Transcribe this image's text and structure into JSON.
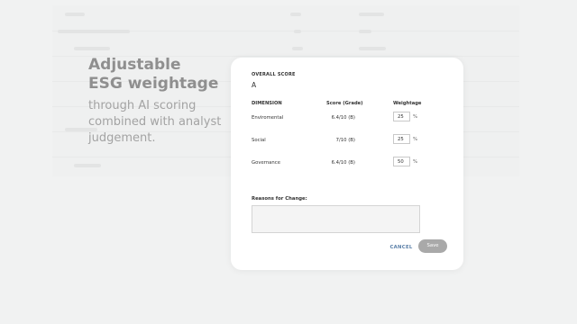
{
  "promo": {
    "title_line1": "Adjustable",
    "title_line2": "ESG weightage",
    "subtitle_line1": "through AI scoring",
    "subtitle_line2": "combined with analyst",
    "subtitle_line3": "judgement."
  },
  "modal": {
    "overall_label": "OVERALL SCORE",
    "overall_value": "A",
    "headers": {
      "dimension": "DIMENSION",
      "score": "Score (Grade)",
      "weightage": "Weightage"
    },
    "rows": [
      {
        "dimension": "Enviromental",
        "score": "6.4/10 (B)",
        "weight": "25",
        "unit": "%"
      },
      {
        "dimension": "Social",
        "score": "7/10 (B)",
        "weight": "25",
        "unit": "%"
      },
      {
        "dimension": "Governance",
        "score": "6.4/10 (B)",
        "weight": "50",
        "unit": "%"
      }
    ],
    "reasons_label": "Reasons for Change:",
    "reasons_value": "",
    "cancel_label": "CANCEL",
    "save_label": "Save"
  },
  "colors": {
    "background": "#f1f2f2",
    "cancel_text": "#5a7fa8",
    "save_button": "#a9a9a9"
  }
}
